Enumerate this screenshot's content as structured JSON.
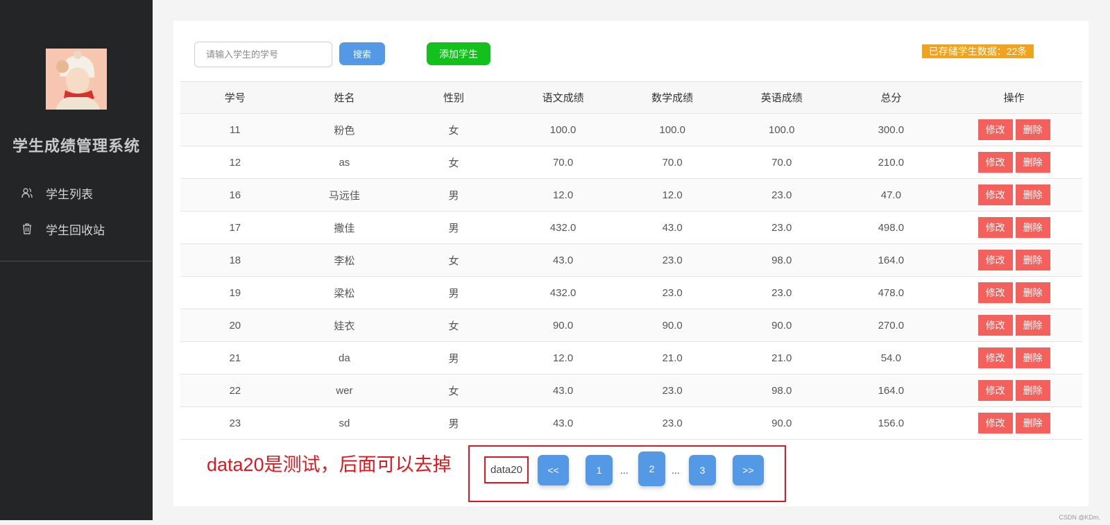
{
  "sidebar": {
    "title": "学生成绩管理系统",
    "items": [
      {
        "label": "学生列表",
        "icon": "user-group-icon"
      },
      {
        "label": "学生回收站",
        "icon": "trash-icon"
      }
    ]
  },
  "toolbar": {
    "search_placeholder": "请输入学生的学号",
    "search_label": "搜索",
    "add_label": "添加学生",
    "count_text": "已存储学生数据：22条"
  },
  "table": {
    "headers": [
      "学号",
      "姓名",
      "性别",
      "语文成绩",
      "数学成绩",
      "英语成绩",
      "总分",
      "操作"
    ],
    "edit_label": "修改",
    "delete_label": "删除",
    "rows": [
      [
        "11",
        "粉色",
        "女",
        "100.0",
        "100.0",
        "100.0",
        "300.0"
      ],
      [
        "12",
        "as",
        "女",
        "70.0",
        "70.0",
        "70.0",
        "210.0"
      ],
      [
        "16",
        "马远佳",
        "男",
        "12.0",
        "12.0",
        "23.0",
        "47.0"
      ],
      [
        "17",
        "撒佳",
        "男",
        "432.0",
        "43.0",
        "23.0",
        "498.0"
      ],
      [
        "18",
        "李松",
        "女",
        "43.0",
        "23.0",
        "98.0",
        "164.0"
      ],
      [
        "19",
        "梁松",
        "男",
        "432.0",
        "23.0",
        "23.0",
        "478.0"
      ],
      [
        "20",
        "娃衣",
        "女",
        "90.0",
        "90.0",
        "90.0",
        "270.0"
      ],
      [
        "21",
        "da",
        "男",
        "12.0",
        "21.0",
        "21.0",
        "54.0"
      ],
      [
        "22",
        "wer",
        "女",
        "43.0",
        "23.0",
        "98.0",
        "164.0"
      ],
      [
        "23",
        "sd",
        "男",
        "43.0",
        "23.0",
        "90.0",
        "156.0"
      ]
    ]
  },
  "annotation": {
    "note": "data20是测试，后面可以去掉",
    "data_label": "data20"
  },
  "pagination": {
    "prev": "<<",
    "pages": [
      "1",
      "2",
      "3"
    ],
    "ellipsis": "...",
    "next": ">>",
    "current": "2"
  },
  "watermark": "CSDN @KDm.",
  "colors": {
    "sidebar_bg": "#242527",
    "primary": "#5499e6",
    "success": "#13c11c",
    "warning": "#f0a31c",
    "danger": "#f4605b",
    "annotation_red": "#e0171e"
  }
}
